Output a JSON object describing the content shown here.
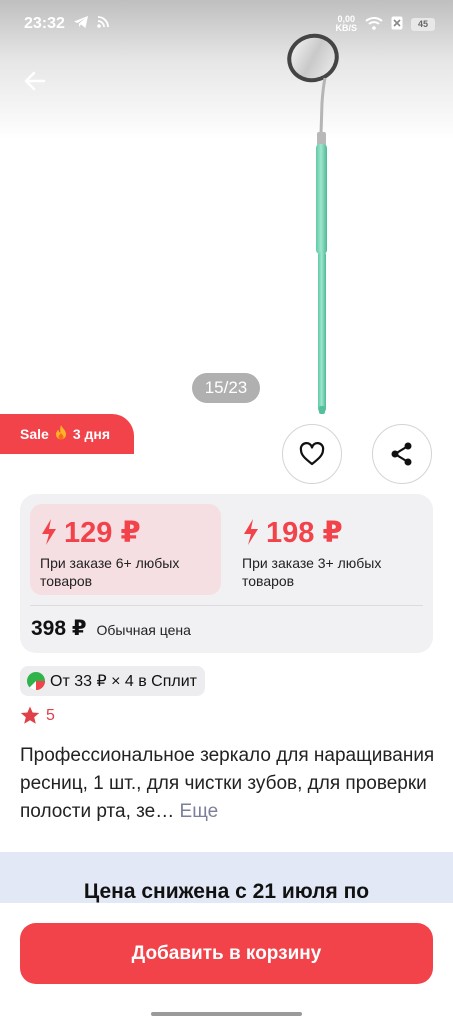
{
  "status_bar": {
    "time": "23:32",
    "net_speed_value": "0,00",
    "net_speed_unit": "KB/S",
    "battery": "45"
  },
  "gallery": {
    "counter": "15/23"
  },
  "sale_badge": {
    "label": "Sale",
    "icon": "fire-icon",
    "duration": "3 дня"
  },
  "price_tiers": [
    {
      "price": "129 ₽",
      "condition": "При заказе 6+ любых товаров"
    },
    {
      "price": "198 ₽",
      "condition": "При заказе 3+ любых товаров"
    }
  ],
  "regular_price": {
    "price": "398 ₽",
    "label": "Обычная цена"
  },
  "split": {
    "text": "От 33 ₽ × 4 в Сплит"
  },
  "rating": {
    "value": "5"
  },
  "description": {
    "text": "Профессиональное зеркало для наращивания ресниц, 1 шт., для чистки зубов, для проверки полости рта, зе…",
    "more_label": "Еще"
  },
  "promo": {
    "text": "Цена снижена с 21 июля по"
  },
  "cart_button": {
    "label": "Добавить в корзину"
  },
  "colors": {
    "accent": "#f2424a",
    "tier_highlight": "#f6dfe3",
    "card_bg": "#f1f1f4",
    "promo_bg": "#e3e8f6"
  }
}
